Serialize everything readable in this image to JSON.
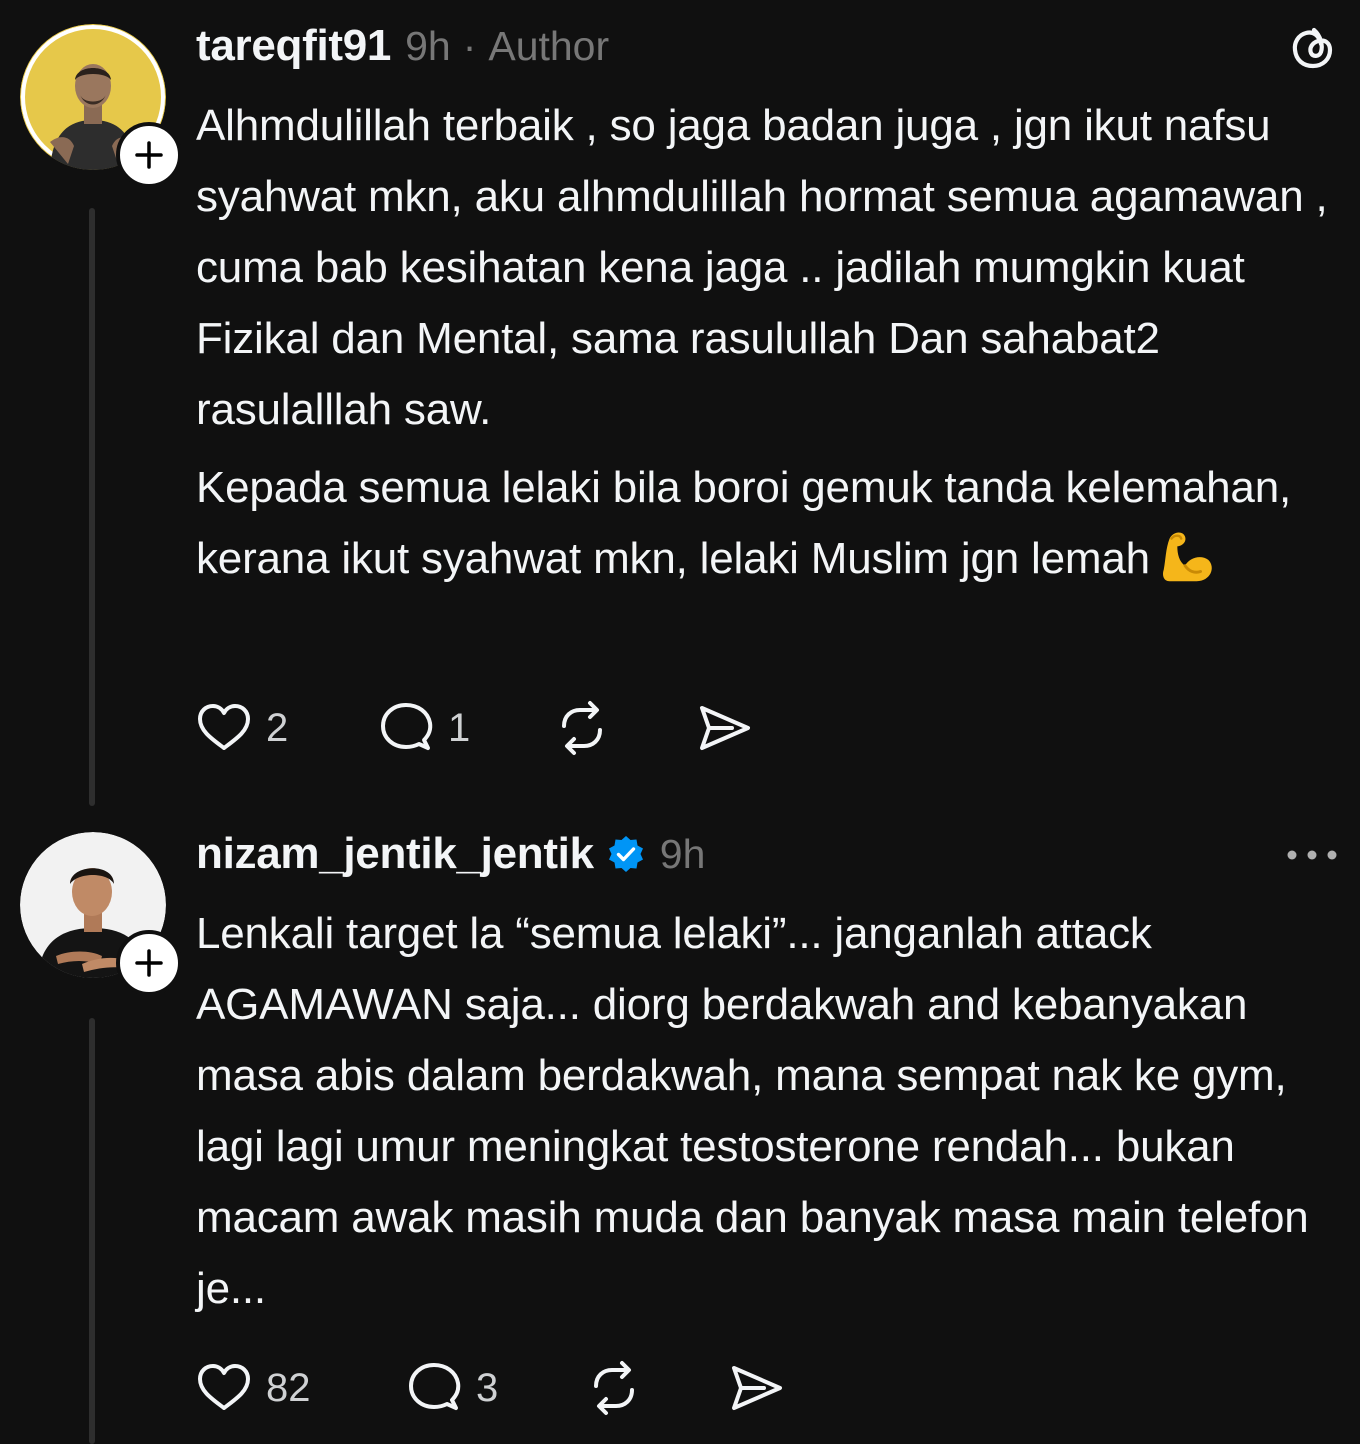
{
  "posts": [
    {
      "username": "tareqfit91",
      "time": "9h",
      "separator": "·",
      "role": "Author",
      "avatar_color": "#e6c84a",
      "paragraphs": [
        "Alhmdulillah terbaik , so jaga badan juga , jgn ikut nafsu syahwat mkn, aku alhmdulillah hormat semua agamawan , cuma bab kesihatan kena jaga .. jadilah mumgkin kuat Fizikal dan Mental, sama rasulullah Dan sahabat2 rasulalllah saw.",
        "Kepada semua lelaki bila boroi gemuk tanda kelemahan, kerana ikut syahwat mkn, lelaki Muslim jgn lemah"
      ],
      "emoji": "flexed-biceps",
      "likes": "2",
      "replies": "1",
      "top_right_icon": "threads-logo-icon"
    },
    {
      "username": "nizam_jentik_jentik",
      "verified": true,
      "time": "9h",
      "avatar_color": "#f2f2f2",
      "paragraphs": [
        "Lenkali target la “semua lelaki”... janganlah attack AGAMAWAN saja... diorg berdakwah and kebanyakan masa abis dalam berdakwah, mana sempat nak ke gym, lagi lagi umur meningkat testosterone rendah... bukan macam awak masih muda dan banyak masa main telefon je..."
      ],
      "likes": "82",
      "replies": "3",
      "top_right_icon": "more-options-icon"
    }
  ],
  "colors": {
    "background": "#101010",
    "text": "#f3f5f7",
    "muted": "#777777",
    "verified": "#0095f6",
    "thread_line": "#2e2e2e"
  }
}
